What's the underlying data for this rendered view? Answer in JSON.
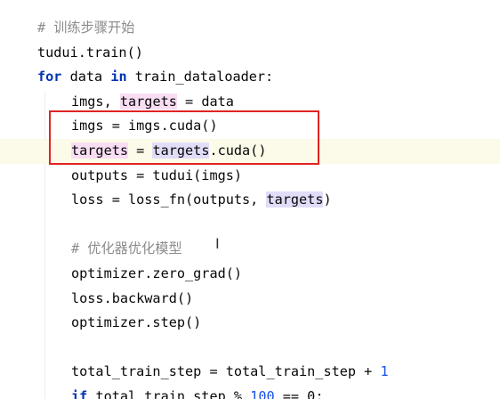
{
  "code_lines": [
    {
      "comment": "# 训练步骤开始"
    },
    {
      "text": "tudui.train()"
    },
    {
      "kw": "for",
      "a": " data ",
      "kw2": "in",
      "b": " train_dataloader:"
    },
    {
      "a": "imgs, ",
      "hl": "targets",
      "b": " = data"
    },
    {
      "a": "imgs = imgs.cuda()"
    },
    {
      "hl": "targets",
      "a": " = ",
      "hl2": "targets",
      "b": ".cuda()"
    },
    {
      "a": "outputs = tudui(imgs)"
    },
    {
      "a": "loss = loss_fn(outputs, ",
      "hl": "targets",
      "b": ")"
    },
    {
      "a": ""
    },
    {
      "comment": "# 优化器优化模型"
    },
    {
      "a": "optimizer.zero_grad()"
    },
    {
      "a": "loss.backward()"
    },
    {
      "a": "optimizer.step()"
    },
    {
      "a": ""
    },
    {
      "a": "total_train_step = total_train_step + ",
      "num": "1"
    },
    {
      "kw": "if",
      "a": " total_train_step % ",
      "num": "100",
      "b": " == 0:"
    }
  ],
  "cursor_glyph": "I"
}
